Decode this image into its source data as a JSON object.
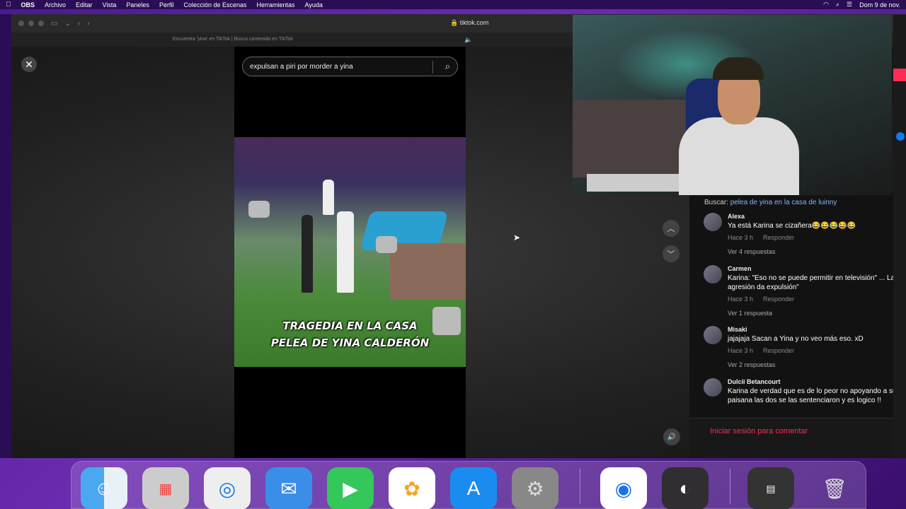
{
  "menubar": {
    "apple": "",
    "app": "OBS",
    "items": [
      "Archivo",
      "Editar",
      "Vista",
      "Paneles",
      "Perfil",
      "Colección de Escenas",
      "Herramientas",
      "Ayuda"
    ],
    "clock": "Dom 9 de nov."
  },
  "browser": {
    "url": "tiktok.com",
    "tab_title": "Encuentra 'yina' en TikTok | Busca contenido en TikTok"
  },
  "search": {
    "value": "expulsan a piri por morder a yina"
  },
  "video": {
    "caption_line1": "TRAGEDIA EN LA CASA",
    "caption_line2": "PELEA DE YINA CALDERÓN"
  },
  "comments": {
    "buscar_label": "Buscar:",
    "buscar_query": "pelea de yina en la casa de luinny",
    "items": [
      {
        "name": "Alexa",
        "text": "Ya está Karina se cizañera😂😂😂😂😂",
        "time": "Hace 3 h",
        "reply": "Responder",
        "more": "Ver 4 respuestas"
      },
      {
        "name": "Carmen",
        "text": "Karina: \"Eso no se puede permitir en televisión\" ... La agresión da expulsión\"",
        "time": "Hace 3 h",
        "reply": "Responder",
        "more": "Ver 1 respuesta"
      },
      {
        "name": "Misaki",
        "text": "jajajaja Sacan a Yina y no veo más eso. xD",
        "time": "Hace 3 h",
        "reply": "Responder",
        "more": "Ver 2 respuestas"
      },
      {
        "name": "Dulcii Betancourt",
        "text": "Karina de verdad que es de lo peor no apoyando a su paisana las dos se las sentenciaron y es logico !!"
      }
    ],
    "login_label": "Iniciar sesión para comentar"
  },
  "dock": {
    "apps": [
      "finder-icon",
      "launchpad-icon",
      "safari-icon",
      "mail-icon",
      "facetime-icon",
      "photos-icon",
      "app-store-icon",
      "system-settings-icon",
      "chrome-icon",
      "obs-icon",
      "trash-icon"
    ]
  },
  "colors": {
    "accent": "#fe2c55",
    "link": "#8ab4f8"
  }
}
